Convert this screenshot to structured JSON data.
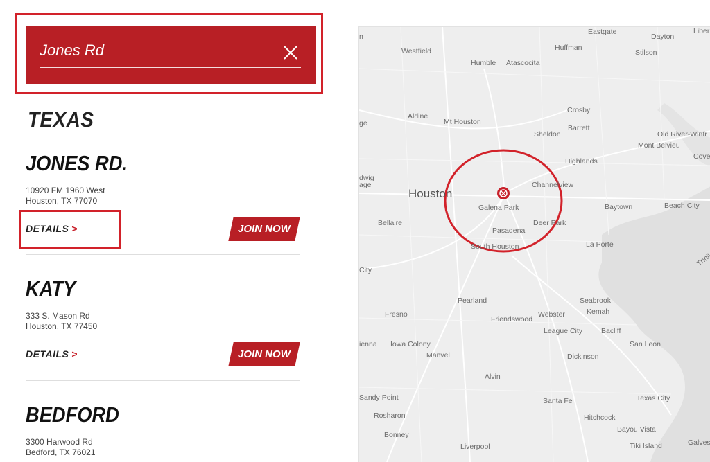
{
  "search": {
    "value": "Jones Rd"
  },
  "state": "TEXAS",
  "locations": [
    {
      "name": "JONES RD.",
      "address1": "10920 FM 1960 West",
      "address2": "Houston, TX 77070",
      "details": "DETAILS",
      "join": "JOIN NOW"
    },
    {
      "name": "KATY",
      "address1": "333 S. Mason Rd",
      "address2": "Houston, TX 77450",
      "details": "DETAILS",
      "join": "JOIN NOW"
    },
    {
      "name": "BEDFORD",
      "address1": "3300 Harwood Rd",
      "address2": "Bedford, TX 76021"
    }
  ],
  "map": {
    "places": [
      "Eastgate",
      "Dayton",
      "Liber",
      "Westfield",
      "Huffman",
      "Stilson",
      "Humble",
      "Atascocita",
      "Crosby",
      "Aldine",
      "Mt Houston",
      "Sheldon",
      "Barrett",
      "Old River-Winfr",
      "Mont Belvieu",
      "Cove",
      "Highlands",
      "Houston",
      "Channelview",
      "Galena Park",
      "Baytown",
      "Beach City",
      "Bellaire",
      "Deer Park",
      "Pasadena",
      "South Houston",
      "La Porte",
      "Trinit",
      "Pearland",
      "Seabrook",
      "Fresno",
      "Webster",
      "Kemah",
      "Friendswood",
      "League City",
      "Bacliff",
      "Iowa Colony",
      "San Leon",
      "Manvel",
      "Dickinson",
      "Alvin",
      "Sandy Point",
      "Santa Fe",
      "Texas City",
      "Rosharon",
      "Hitchcock",
      "Bayou Vista",
      "Bonney",
      "Liverpool",
      "Tiki Island",
      "Galves",
      "n",
      "ge",
      "dwig",
      "age",
      "City",
      "ienna"
    ]
  },
  "colors": {
    "brand": "#b81f25",
    "highlight": "#d2222a"
  }
}
